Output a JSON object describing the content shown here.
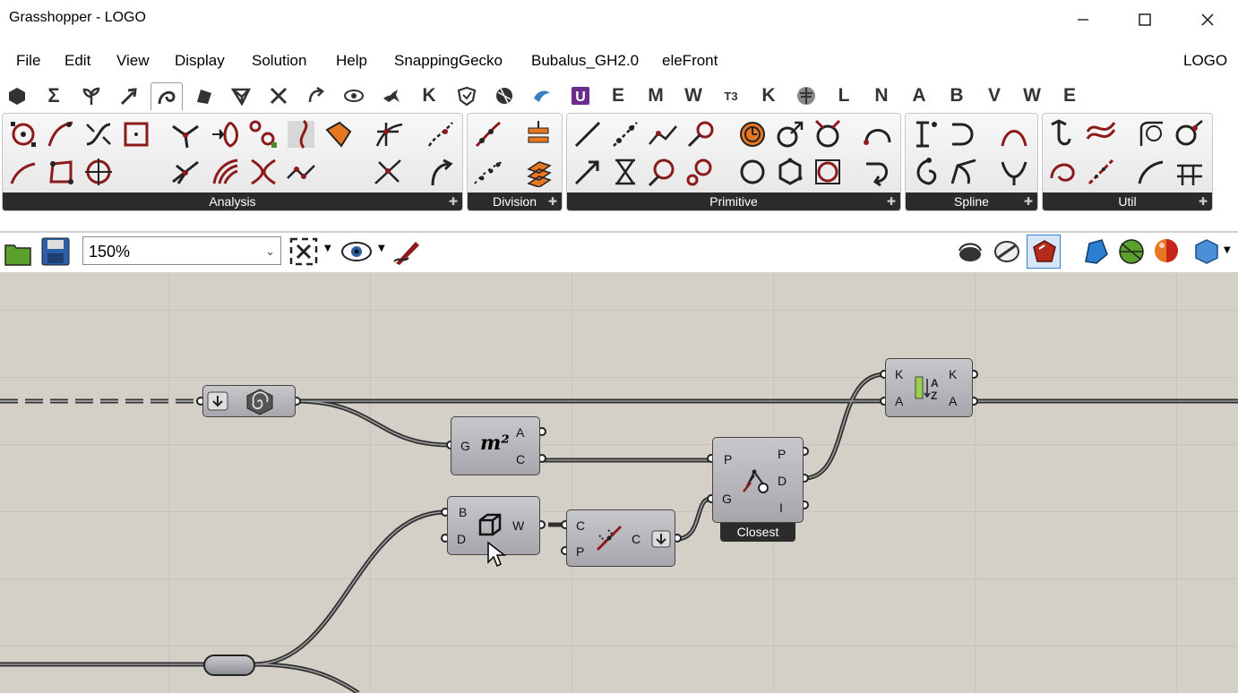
{
  "window": {
    "title": "Grasshopper - LOGO"
  },
  "menu": {
    "items": [
      "File",
      "Edit",
      "View",
      "Display",
      "Solution",
      "Help",
      "SnappingGecko",
      "Bubalus_GH2.0",
      "eleFront"
    ],
    "right_label": "LOGO"
  },
  "tabs": {
    "letters": [
      "K",
      "E",
      "M",
      "W",
      "K",
      "L",
      "N",
      "A",
      "B",
      "V",
      "W",
      "E"
    ],
    "t3": "T3"
  },
  "panels": [
    "Analysis",
    "Division",
    "Primitive",
    "Spline",
    "Util"
  ],
  "toolbar": {
    "zoom": "150%"
  },
  "canvas": {
    "area": {
      "inputs": [
        "G"
      ],
      "outputs": [
        "A",
        "C"
      ],
      "icon_text": "m²"
    },
    "box": {
      "inputs": [
        "B",
        "D"
      ],
      "outputs": [
        "W"
      ]
    },
    "pull": {
      "inputs": [
        "C",
        "P"
      ],
      "outputs": [
        "C"
      ]
    },
    "closest": {
      "inputs": [
        "P",
        "G"
      ],
      "outputs": [
        "P",
        "D",
        "I"
      ],
      "label": "Closest"
    },
    "sort": {
      "inputs": [
        "K",
        "A"
      ],
      "outputs": [
        "K",
        "A"
      ]
    }
  },
  "colors": {
    "canvas": "#d4d0c8",
    "panel_label": "#2b2b2b",
    "icon_red": "#8c1a1a",
    "accent_orange": "#e87722"
  }
}
